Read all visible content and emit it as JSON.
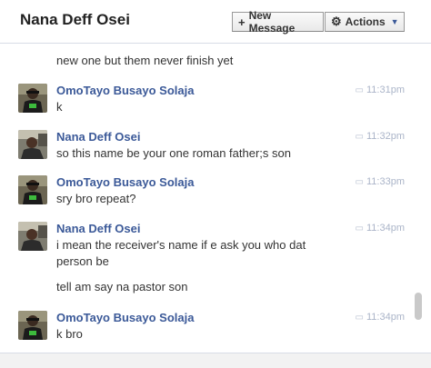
{
  "header": {
    "title": "Nana Deff Osei",
    "new_message_label": "New Message",
    "new_message_icon": "plus-icon",
    "actions_label": "Actions",
    "actions_icon": "gear-icon"
  },
  "partial_message": {
    "line": "new one but them never finish yet"
  },
  "messages": [
    {
      "author": "OmoTayo Busayo Solaja",
      "time": "11:31pm",
      "lines": [
        "k"
      ]
    },
    {
      "author": "Nana Deff Osei",
      "time": "11:32pm",
      "lines": [
        "so this name be your one roman father;s son"
      ]
    },
    {
      "author": "OmoTayo Busayo Solaja",
      "time": "11:33pm",
      "lines": [
        "sry bro repeat?"
      ]
    },
    {
      "author": "Nana Deff Osei",
      "time": "11:34pm",
      "lines": [
        "i mean the receiver's name if e ask you who dat",
        "person be",
        "tell am say na pastor son"
      ]
    },
    {
      "author": "OmoTayo Busayo Solaja",
      "time": "11:34pm",
      "lines": [
        "k bro"
      ]
    }
  ],
  "colors": {
    "link_blue": "#3b5998",
    "timestamp": "#aab4c8"
  }
}
